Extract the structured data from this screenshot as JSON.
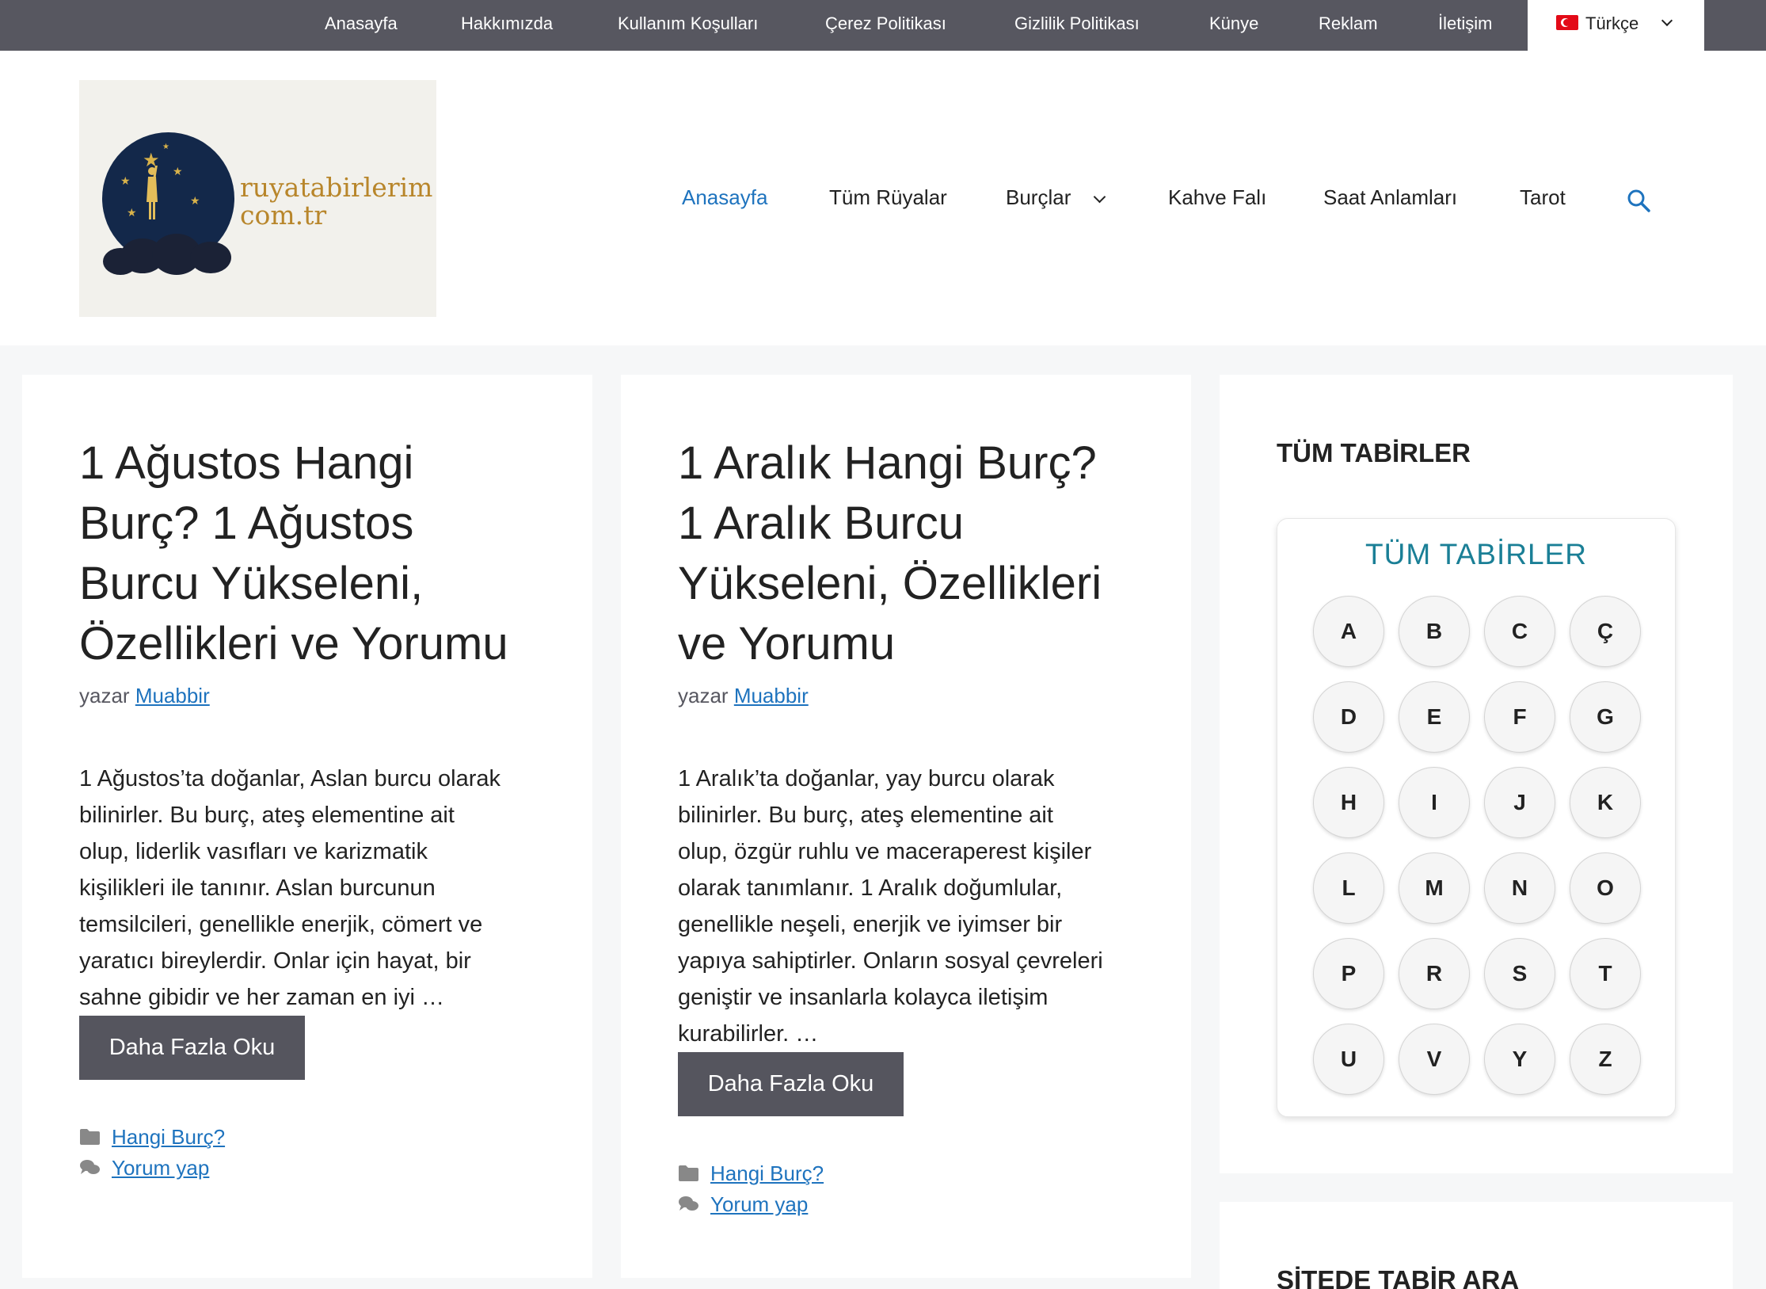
{
  "topbar": {
    "links": [
      "Anasayfa",
      "Hakkımızda",
      "Kullanım Koşulları",
      "Çerez Politikası",
      "Gizlilik Politikası",
      "Künye",
      "Reklam",
      "İletişim"
    ],
    "language": "Türkçe"
  },
  "logo": {
    "line1": "ruyatabirlerim",
    "line2": "com.tr"
  },
  "nav": {
    "items": [
      "Anasayfa",
      "Tüm Rüyalar",
      "Burçlar",
      "Kahve Falı",
      "Saat Anlamları",
      "Tarot"
    ],
    "active": "Anasayfa"
  },
  "posts": [
    {
      "title_lines": [
        "1 Ağustos Hangi",
        "Burç? 1 Ağustos",
        "Burcu Yükseleni,",
        "Özellikleri ve Yorumu"
      ],
      "author_prefix": "yazar",
      "author": "Muabbir",
      "excerpt_lines": [
        "1 Ağustos’ta doğanlar, Aslan burcu olarak",
        "bilinirler. Bu burç, ateş elementine ait",
        "olup, liderlik vasıfları ve karizmatik",
        "kişilikleri ile tanınır. Aslan burcunun",
        "temsilcileri, genellikle enerjik, cömert ve",
        "yaratıcı bireylerdir. Onlar için hayat, bir",
        "sahne gibidir ve her zaman en iyi …"
      ],
      "read_more": "Daha Fazla Oku",
      "category": "Hangi Burç?",
      "comments": "Yorum yap"
    },
    {
      "title_lines": [
        "1 Aralık Hangi Burç?",
        "1 Aralık Burcu",
        "Yükseleni, Özellikleri",
        "ve Yorumu"
      ],
      "author_prefix": "yazar",
      "author": "Muabbir",
      "excerpt_lines": [
        "1 Aralık’ta doğanlar, yay burcu olarak",
        "bilinirler. Bu burç, ateş elementine ait",
        "olup, özgür ruhlu ve maceraperest kişiler",
        "olarak tanımlanır. 1 Aralık doğumlular,",
        "genellikle neşeli, enerjik ve iyimser bir",
        "yapıya sahiptirler. Onların sosyal çevreleri",
        "geniştir ve insanlarla kolayca iletişim",
        "kurabilirler. …"
      ],
      "read_more": "Daha Fazla Oku",
      "category": "Hangi Burç?",
      "comments": "Yorum yap"
    }
  ],
  "sidebar": {
    "widget1_title": "TÜM TABİRLER",
    "alphabet_title": "TÜM TABİRLER",
    "letters": [
      "A",
      "B",
      "C",
      "Ç",
      "D",
      "E",
      "F",
      "G",
      "H",
      "I",
      "J",
      "K",
      "L",
      "M",
      "N",
      "O",
      "P",
      "R",
      "S",
      "T",
      "U",
      "V",
      "Y",
      "Z"
    ],
    "widget2_title": "SİTEDE TABİR ARA"
  },
  "colors": {
    "topbar": "#575760",
    "link": "#1e73be",
    "button": "#55555e",
    "alpha_title": "#1a7f96"
  }
}
